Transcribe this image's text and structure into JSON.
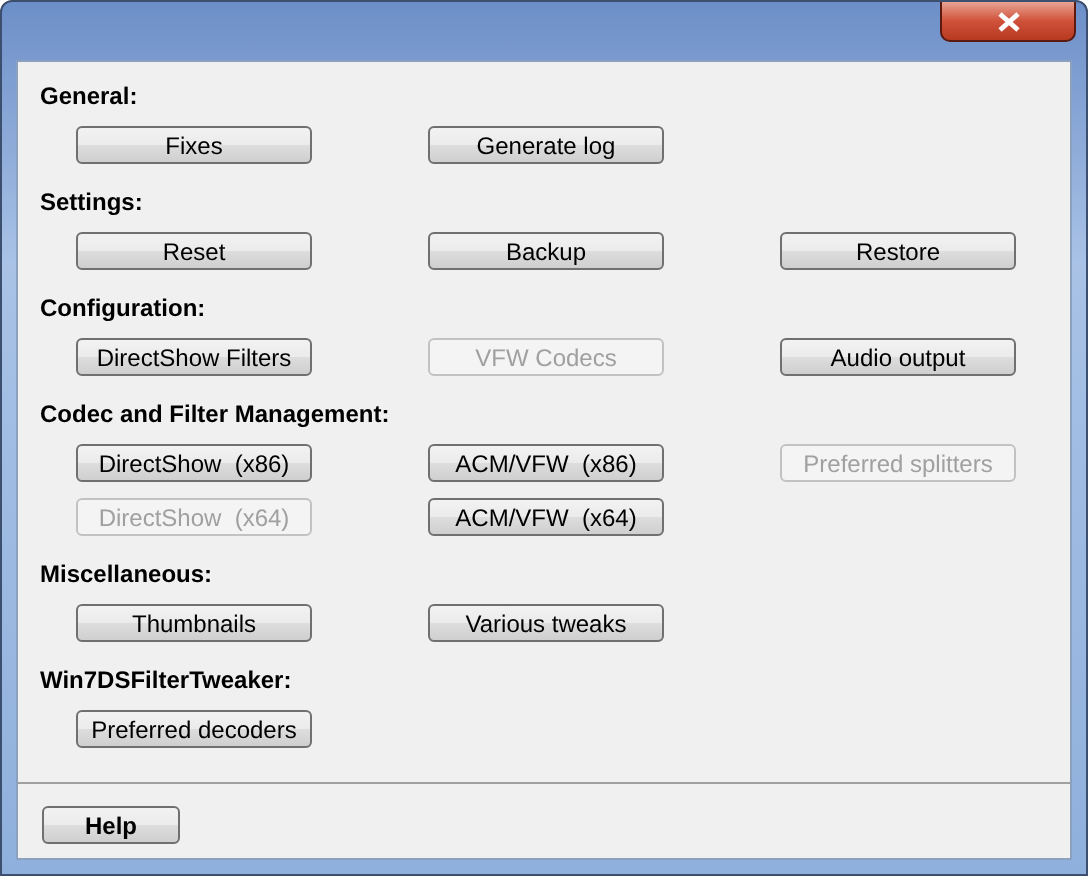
{
  "window": {
    "close_button": true
  },
  "sections": [
    {
      "heading": "General:",
      "rows": [
        [
          {
            "label": "Fixes",
            "disabled": false
          },
          {
            "label": "Generate log",
            "disabled": false
          }
        ]
      ]
    },
    {
      "heading": "Settings:",
      "rows": [
        [
          {
            "label": "Reset",
            "disabled": false
          },
          {
            "label": "Backup",
            "disabled": false
          },
          {
            "label": "Restore",
            "disabled": false
          }
        ]
      ]
    },
    {
      "heading": "Configuration:",
      "rows": [
        [
          {
            "label": "DirectShow Filters",
            "disabled": false
          },
          {
            "label": "VFW Codecs",
            "disabled": true
          },
          {
            "label": "Audio output",
            "disabled": false
          }
        ]
      ]
    },
    {
      "heading": "Codec and Filter Management:",
      "rows": [
        [
          {
            "label": "DirectShow  (x86)",
            "disabled": false
          },
          {
            "label": "ACM/VFW  (x86)",
            "disabled": false
          },
          {
            "label": "Preferred splitters",
            "disabled": true
          }
        ],
        [
          {
            "label": "DirectShow  (x64)",
            "disabled": true
          },
          {
            "label": "ACM/VFW  (x64)",
            "disabled": false
          }
        ]
      ]
    },
    {
      "heading": "Miscellaneous:",
      "rows": [
        [
          {
            "label": "Thumbnails",
            "disabled": false
          },
          {
            "label": "Various tweaks",
            "disabled": false
          }
        ]
      ]
    },
    {
      "heading": "Win7DSFilterTweaker:",
      "rows": [
        [
          {
            "label": "Preferred decoders",
            "disabled": false
          }
        ]
      ]
    }
  ],
  "footer": {
    "help_button": "Help"
  }
}
